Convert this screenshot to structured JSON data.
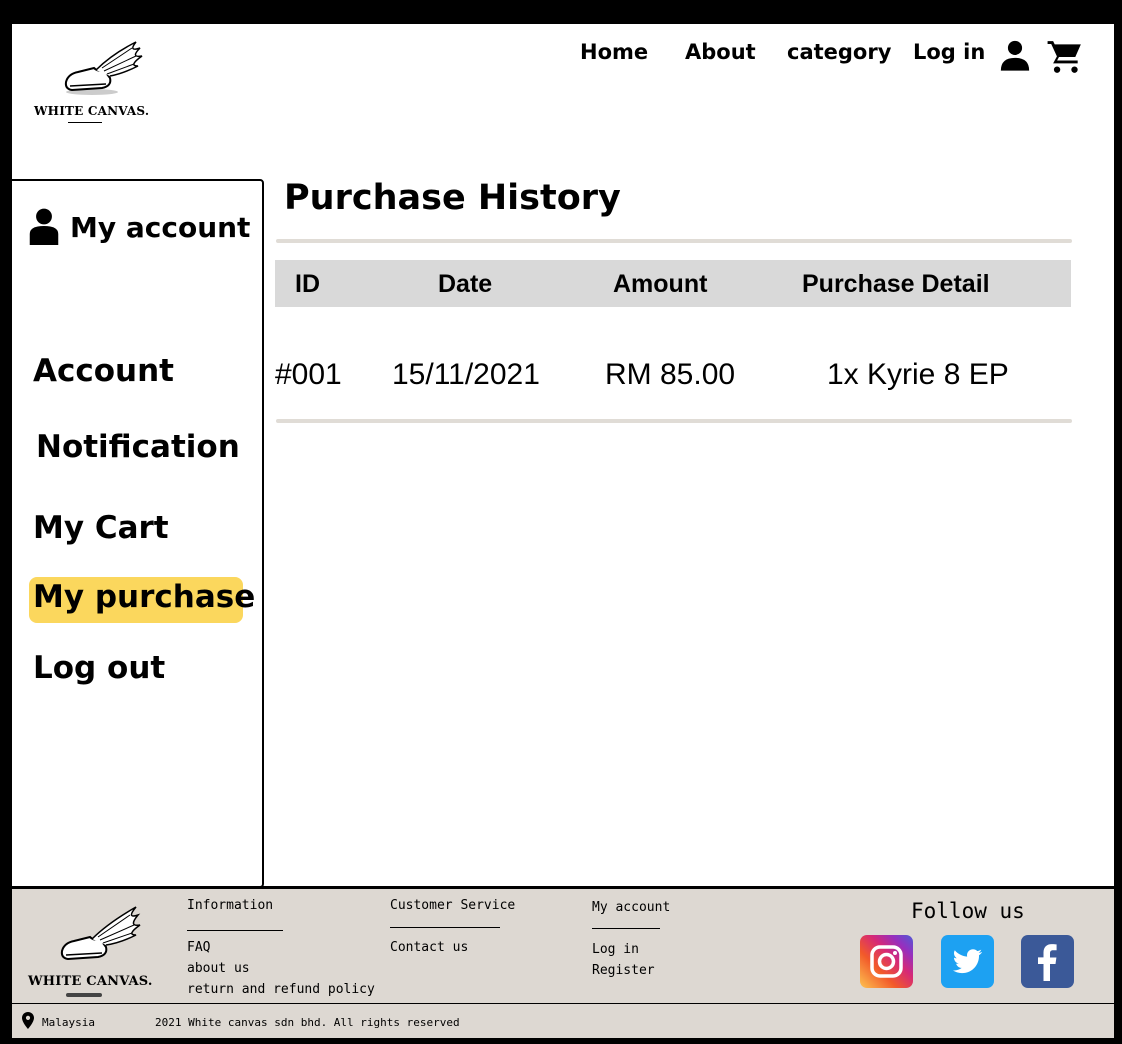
{
  "brand": {
    "name": "WHITE CANVAS."
  },
  "nav": {
    "items": [
      "Home",
      "About",
      "category",
      "Log in"
    ],
    "icons": [
      "user-icon",
      "cart-icon"
    ]
  },
  "sidebar": {
    "title": "My account",
    "items": [
      {
        "label": "Account",
        "active": false
      },
      {
        "label": "Notification",
        "active": false
      },
      {
        "label": "My Cart",
        "active": false
      },
      {
        "label": "My purchase",
        "active": true
      },
      {
        "label": "Log out",
        "active": false
      }
    ]
  },
  "main": {
    "title": "Purchase History",
    "table": {
      "headers": [
        "ID",
        "Date",
        "Amount",
        "Purchase Detail"
      ],
      "rows": [
        [
          "#001",
          "15/11/2021",
          "RM 85.00",
          "1x Kyrie 8 EP"
        ]
      ]
    }
  },
  "footer": {
    "columns": [
      {
        "title": "Information",
        "links": [
          "FAQ",
          "about us",
          "return and refund policy"
        ]
      },
      {
        "title": "Customer Service",
        "links": [
          "Contact us"
        ]
      },
      {
        "title": "My account",
        "links": [
          "Log in",
          "Register"
        ]
      }
    ],
    "follow_title": "Follow us",
    "socials": [
      "instagram-icon",
      "twitter-icon",
      "facebook-icon"
    ],
    "location": "Malaysia",
    "copyright": "2021 White canvas sdn bhd. All rights reserved"
  },
  "colors": {
    "active_highlight": "#fbd75d",
    "footer_bg": "#ddd8d2",
    "table_header_bg": "#d9d9d9",
    "twitter": "#1da1f2",
    "facebook": "#3b5998"
  }
}
